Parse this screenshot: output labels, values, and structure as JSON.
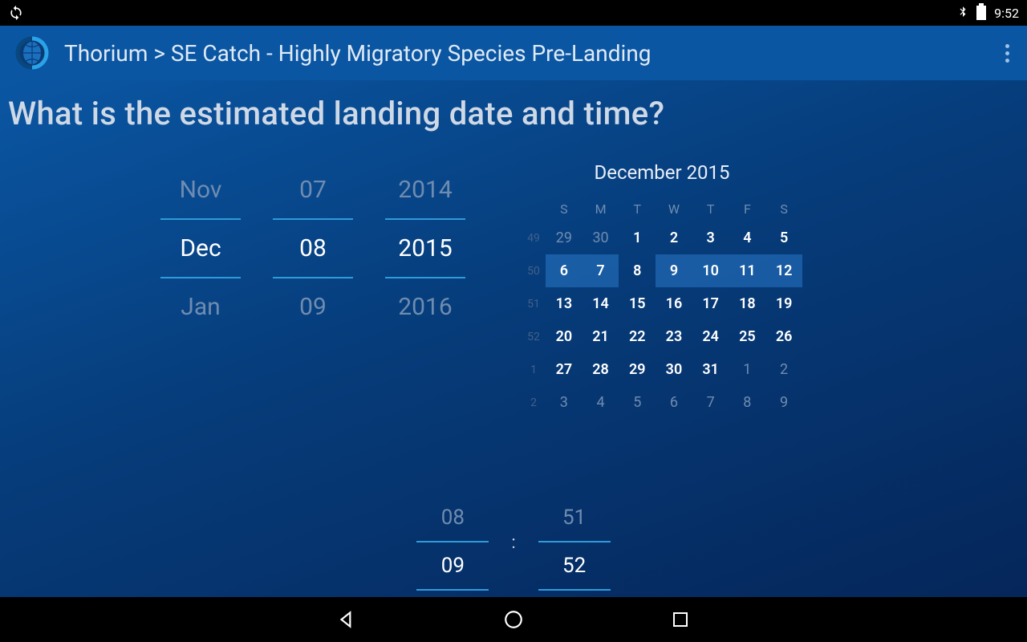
{
  "status": {
    "time": "9:52"
  },
  "action_bar": {
    "title": "Thorium > SE Catch - Highly Migratory Species Pre-Landing"
  },
  "question": "What is the estimated landing date and time?",
  "date_spinner": {
    "month": {
      "prev": "Nov",
      "cur": "Dec",
      "next": "Jan"
    },
    "day": {
      "prev": "07",
      "cur": "08",
      "next": "09"
    },
    "year": {
      "prev": "2014",
      "cur": "2015",
      "next": "2016"
    }
  },
  "calendar": {
    "title": "December 2015",
    "dow": [
      "S",
      "M",
      "T",
      "W",
      "T",
      "F",
      "S"
    ],
    "weeks": [
      {
        "wk": "49",
        "days": [
          {
            "n": "29",
            "dim": true
          },
          {
            "n": "30",
            "dim": true
          },
          {
            "n": "1"
          },
          {
            "n": "2"
          },
          {
            "n": "3"
          },
          {
            "n": "4"
          },
          {
            "n": "5"
          }
        ]
      },
      {
        "wk": "50",
        "days": [
          {
            "n": "6",
            "range": "left"
          },
          {
            "n": "7",
            "range": "left"
          },
          {
            "n": "8",
            "range": "gap"
          },
          {
            "n": "9",
            "range": "right"
          },
          {
            "n": "10",
            "range": "right"
          },
          {
            "n": "11",
            "range": "right"
          },
          {
            "n": "12",
            "range": "right"
          }
        ]
      },
      {
        "wk": "51",
        "days": [
          {
            "n": "13"
          },
          {
            "n": "14"
          },
          {
            "n": "15"
          },
          {
            "n": "16"
          },
          {
            "n": "17"
          },
          {
            "n": "18"
          },
          {
            "n": "19"
          }
        ]
      },
      {
        "wk": "52",
        "days": [
          {
            "n": "20"
          },
          {
            "n": "21"
          },
          {
            "n": "22"
          },
          {
            "n": "23"
          },
          {
            "n": "24"
          },
          {
            "n": "25"
          },
          {
            "n": "26"
          }
        ]
      },
      {
        "wk": "1",
        "days": [
          {
            "n": "27"
          },
          {
            "n": "28"
          },
          {
            "n": "29"
          },
          {
            "n": "30"
          },
          {
            "n": "31"
          },
          {
            "n": "1",
            "dim": true
          },
          {
            "n": "2",
            "dim": true
          }
        ]
      },
      {
        "wk": "2",
        "days": [
          {
            "n": "3",
            "dim": true
          },
          {
            "n": "4",
            "dim": true
          },
          {
            "n": "5",
            "dim": true
          },
          {
            "n": "6",
            "dim": true
          },
          {
            "n": "7",
            "dim": true
          },
          {
            "n": "8",
            "dim": true
          },
          {
            "n": "9",
            "dim": true
          }
        ]
      }
    ]
  },
  "time_spinner": {
    "hour": {
      "prev": "08",
      "cur": "09"
    },
    "minute": {
      "prev": "51",
      "cur": "52"
    },
    "sep": ":"
  }
}
